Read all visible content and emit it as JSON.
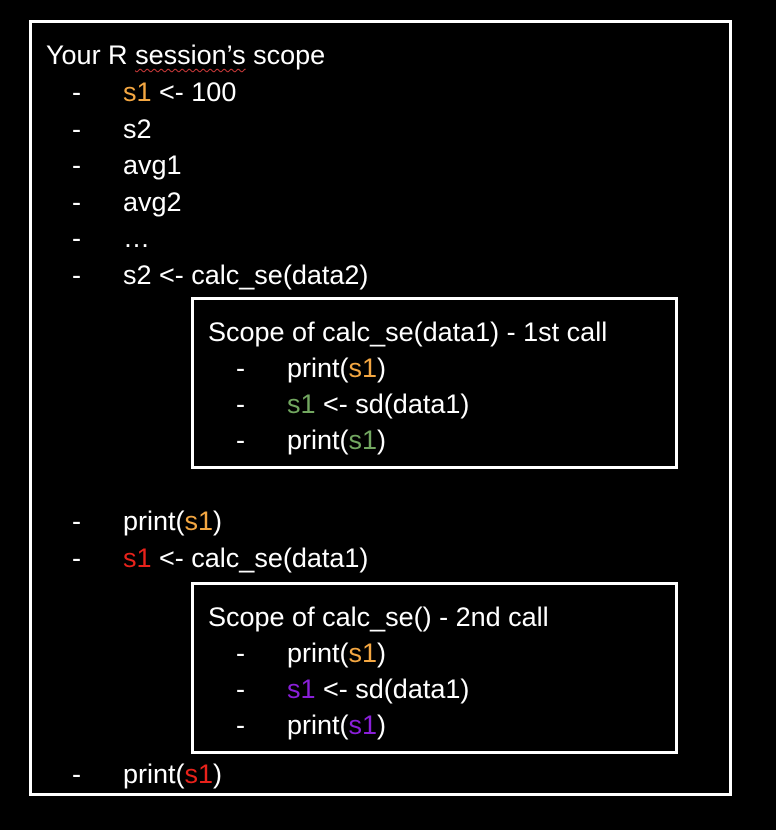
{
  "outer": {
    "title_prefix": "Your R ",
    "title_word": "session’s",
    "title_suffix": " scope",
    "lines": [
      {
        "dash": "-",
        "parts": [
          {
            "text": "s1",
            "color": "#f4a742"
          },
          {
            "text": " <- 100",
            "color": "#ffffff"
          }
        ]
      },
      {
        "dash": "-",
        "parts": [
          {
            "text": "s2",
            "color": "#ffffff"
          }
        ]
      },
      {
        "dash": "-",
        "parts": [
          {
            "text": "avg1",
            "color": "#ffffff"
          }
        ]
      },
      {
        "dash": "-",
        "parts": [
          {
            "text": "avg2",
            "color": "#ffffff"
          }
        ]
      },
      {
        "dash": "-",
        "parts": [
          {
            "text": "…",
            "color": "#ffffff"
          }
        ]
      },
      {
        "dash": "-",
        "parts": [
          {
            "text": "s2 <- calc_se(data2)",
            "color": "#ffffff"
          }
        ]
      }
    ],
    "lines_after_box1": [
      {
        "dash": "-",
        "parts": [
          {
            "text": "print(",
            "color": "#ffffff"
          },
          {
            "text": "s1",
            "color": "#f4a742"
          },
          {
            "text": ")",
            "color": "#ffffff"
          }
        ]
      },
      {
        "dash": "-",
        "parts": [
          {
            "text": "s1",
            "color": "#e8221b"
          },
          {
            "text": " <- calc_se(data1)",
            "color": "#ffffff"
          }
        ]
      }
    ],
    "lines_after_box2": [
      {
        "dash": "-",
        "parts": [
          {
            "text": "print(",
            "color": "#ffffff"
          },
          {
            "text": "s1",
            "color": "#e8221b"
          },
          {
            "text": ")",
            "color": "#ffffff"
          }
        ]
      }
    ]
  },
  "box1": {
    "title": "Scope of calc_se(data1) - 1st call",
    "lines": [
      {
        "dash": "-",
        "parts": [
          {
            "text": "print(",
            "color": "#ffffff"
          },
          {
            "text": "s1",
            "color": "#f4a742"
          },
          {
            "text": ")",
            "color": "#ffffff"
          }
        ]
      },
      {
        "dash": "-",
        "parts": [
          {
            "text": "s1",
            "color": "#72a760"
          },
          {
            "text": " <- sd(data1)",
            "color": "#ffffff"
          }
        ]
      },
      {
        "dash": "-",
        "parts": [
          {
            "text": "print(",
            "color": "#ffffff"
          },
          {
            "text": "s1",
            "color": "#72a760"
          },
          {
            "text": ")",
            "color": "#ffffff"
          }
        ]
      }
    ]
  },
  "box2": {
    "title": "Scope of calc_se() - 2nd call",
    "lines": [
      {
        "dash": "-",
        "parts": [
          {
            "text": "print(",
            "color": "#ffffff"
          },
          {
            "text": "s1",
            "color": "#f4a742"
          },
          {
            "text": ")",
            "color": "#ffffff"
          }
        ]
      },
      {
        "dash": "-",
        "parts": [
          {
            "text": "s1",
            "color": "#8a1fd9"
          },
          {
            "text": " <- sd(data1)",
            "color": "#ffffff"
          }
        ]
      },
      {
        "dash": "-",
        "parts": [
          {
            "text": "print(",
            "color": "#ffffff"
          },
          {
            "text": "s1",
            "color": "#8a1fd9"
          },
          {
            "text": ")",
            "color": "#ffffff"
          }
        ]
      }
    ]
  }
}
